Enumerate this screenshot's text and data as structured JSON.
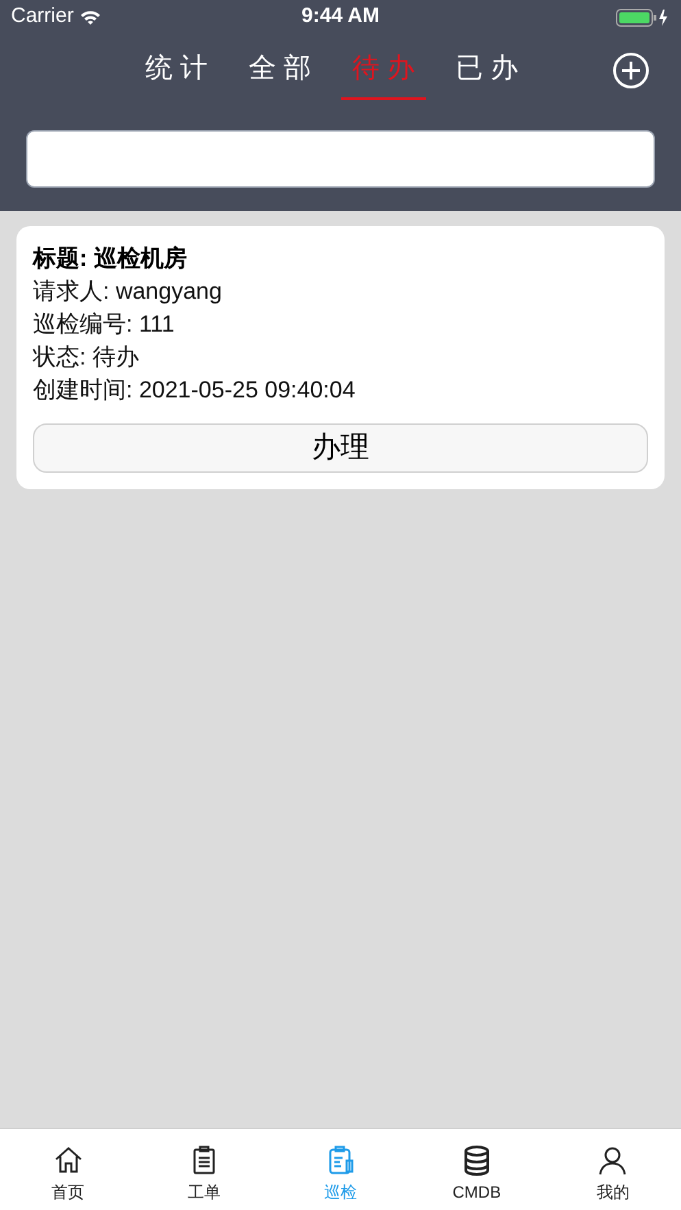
{
  "status_bar": {
    "carrier": "Carrier",
    "time": "9:44 AM"
  },
  "tabs": [
    {
      "label": "统 计",
      "selected": false
    },
    {
      "label": "全 部",
      "selected": false
    },
    {
      "label": "待 办",
      "selected": true
    },
    {
      "label": "已 办",
      "selected": false
    }
  ],
  "cards": [
    {
      "lines": [
        {
          "kind": "title",
          "text": "标题: 巡检机房"
        },
        {
          "kind": "field",
          "text": "请求人: wangyang"
        },
        {
          "kind": "field",
          "text": "巡检编号: 111"
        },
        {
          "kind": "field",
          "text": "状态: 待办"
        },
        {
          "kind": "field",
          "text": "创建时间: 2021-05-25 09:40:04"
        }
      ],
      "button": "办理"
    }
  ],
  "tab_bar": [
    {
      "kind": "home",
      "label": "首页",
      "selected": false
    },
    {
      "kind": "clipboard",
      "label": "工单",
      "selected": false
    },
    {
      "kind": "inspect",
      "label": "巡检",
      "selected": true
    },
    {
      "kind": "database",
      "label": "CMDB",
      "selected": false
    },
    {
      "kind": "person",
      "label": "我的",
      "selected": false
    }
  ]
}
